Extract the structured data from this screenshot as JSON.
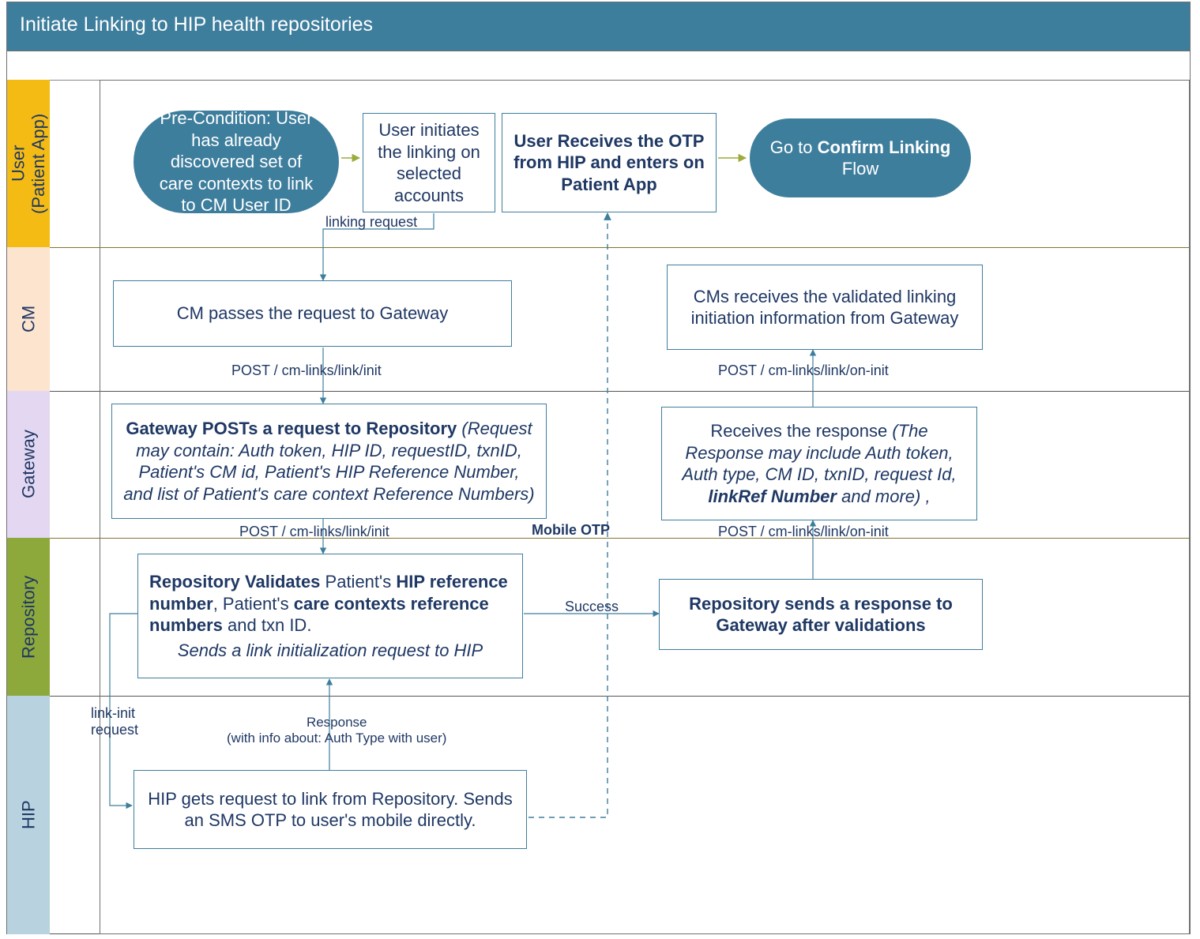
{
  "title": "Initiate Linking to HIP health repositories",
  "lanes": {
    "user": "User\n(Patient App)",
    "cm": "CM",
    "gateway": "Gateway",
    "repo": "Repository",
    "hip": "HIP"
  },
  "nodes": {
    "precondition": "Pre-Condition: User has already discovered set of care contexts to link to CM User ID",
    "user_initiates": "User initiates the linking on selected accounts",
    "user_receives_otp": "User Receives the OTP from HIP and enters on Patient App",
    "goto_confirm": [
      "Go to ",
      "Confirm Linking",
      " Flow"
    ],
    "cm_passes": "CM passes the request to Gateway",
    "cm_receives": "CMs receives the  validated linking initiation information from Gateway",
    "gateway_posts_prefix": "Gateway POSTs a request to Repository ",
    "gateway_posts_detail": "(Request may contain: Auth token, HIP ID, requestID, txnID, Patient's CM id, Patient's HIP Reference Number, and list of Patient's care context Reference Numbers)",
    "gateway_receives_prefix": "Receives the response ",
    "gateway_receives_detail_1": "(The Response may include Auth token, Auth type, CM ID, txnID, request Id, ",
    "gateway_receives_linkref": "linkRef Number",
    "gateway_receives_detail_2": " and more) ,",
    "repo_validates_parts": [
      "Repository Validates",
      " Patient's ",
      "HIP reference number",
      ", Patient's ",
      "care contexts reference numbers",
      " and txn ID."
    ],
    "repo_validates_sub": "Sends a link initialization request to HIP",
    "repo_sends": "Repository sends a response to Gateway after validations",
    "hip_gets": "HIP gets request to link from Repository. Sends an SMS OTP to user's mobile directly."
  },
  "labels": {
    "linking_request": "linking request",
    "post_init": "POST / cm-links/link/init",
    "post_init2": "POST / cm-links/link/init",
    "success": "Success",
    "mobile_otp": "Mobile OTP",
    "post_on_init": "POST / cm-links/link/on-init",
    "post_on_init2": "POST / cm-links/link/on-init",
    "link_init_req": "link-init\nrequest",
    "response_hip": "Response\n(with info about: Auth Type with user)"
  }
}
